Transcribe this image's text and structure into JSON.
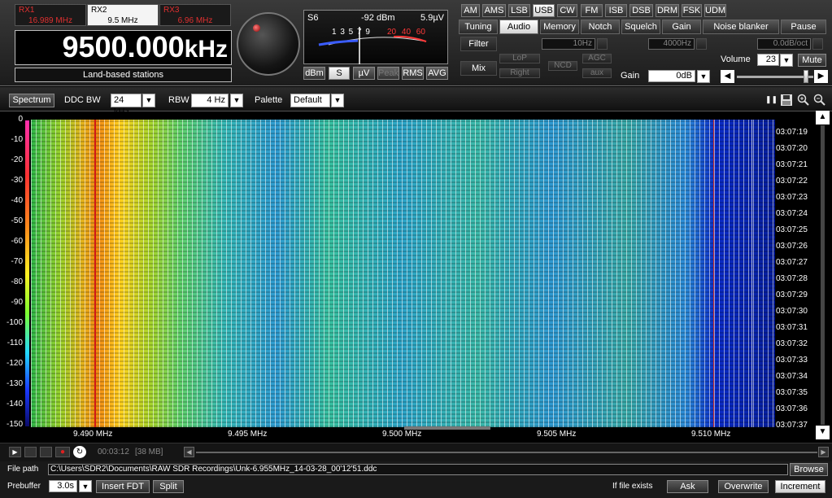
{
  "receivers": [
    {
      "name": "RX1",
      "freq": "16.989 MHz"
    },
    {
      "name": "RX2",
      "freq": "9.5 MHz"
    },
    {
      "name": "RX3",
      "freq": "6.96 MHz"
    }
  ],
  "frequency": {
    "value": "9500.000",
    "unit": "kHz"
  },
  "band_label": "Land-based stations",
  "smeter": {
    "s_reading": "S6",
    "dbm_reading": "-92 dBm",
    "uv_reading": "5.9µV",
    "scale_white": "1 3 5 7 9",
    "scale_red": "20 40 60",
    "buttons": [
      "dBm",
      "S",
      "µV",
      "Peak",
      "RMS",
      "AVG"
    ]
  },
  "modes": [
    "AM",
    "AMS",
    "LSB",
    "USB",
    "CW",
    "FM",
    "ISB",
    "DSB",
    "DRM",
    "FSK",
    "UDM"
  ],
  "active_mode": "USB",
  "func_tabs": [
    "Tuning",
    "Audio",
    "Memory",
    "Notch",
    "Squelch",
    "Gain",
    "Noise blanker",
    "Pause"
  ],
  "active_tab": "Audio",
  "audio": {
    "filter_label": "Filter",
    "mix_label": "Mix",
    "filter_low": "10Hz",
    "filter_high": "4000Hz",
    "filter_slope": "0.0dB/oct",
    "low_pass": "LoP",
    "high_pass": "HiP",
    "agc": "AGC",
    "ncd": "NCD",
    "right": "Right",
    "aux": "aux",
    "gain_label": "Gain",
    "gain_value": "0dB",
    "volume_label": "Volume",
    "volume_value": "23",
    "mute_label": "Mute",
    "volume_level": 0.93
  },
  "toolbar": {
    "spectrum_btn": "Spectrum",
    "ddc_bw_label": "DDC BW",
    "ddc_bw_value": "24 kHz",
    "rbw_label": "RBW",
    "rbw_value": "4 Hz",
    "palette_label": "Palette",
    "palette_value": "Default"
  },
  "waterfall": {
    "y_ticks": [
      "0",
      "-10",
      "-20",
      "-30",
      "-40",
      "-50",
      "-60",
      "-70",
      "-80",
      "-90",
      "-100",
      "-110",
      "-120",
      "-130",
      "-140",
      "-150"
    ],
    "time_ticks": [
      "03:07:19",
      "03:07:20",
      "03:07:21",
      "03:07:22",
      "03:07:23",
      "03:07:24",
      "03:07:25",
      "03:07:26",
      "03:07:27",
      "03:07:28",
      "03:07:29",
      "03:07:30",
      "03:07:31",
      "03:07:32",
      "03:07:33",
      "03:07:34",
      "03:07:35",
      "03:07:36",
      "03:07:37"
    ],
    "x_ticks": [
      "9.490 MHz",
      "9.495 MHz",
      "9.500 MHz",
      "9.505 MHz",
      "9.510 MHz"
    ]
  },
  "playback": {
    "time": "00:03:12",
    "size": "[38 MB]"
  },
  "bottom": {
    "filepath_label": "File path",
    "filepath": "C:\\Users\\SDR2\\Documents\\RAW SDR Recordings\\Unk-6.955MHz_14-03-28_00'12'51.ddc",
    "browse": "Browse",
    "prebuffer_label": "Prebuffer",
    "prebuffer_value": "3.0s",
    "insert_fdt": "Insert FDT",
    "split": "Split",
    "if_exists_label": "If file exists",
    "ask": "Ask",
    "overwrite": "Overwrite",
    "increment": "Increment"
  }
}
